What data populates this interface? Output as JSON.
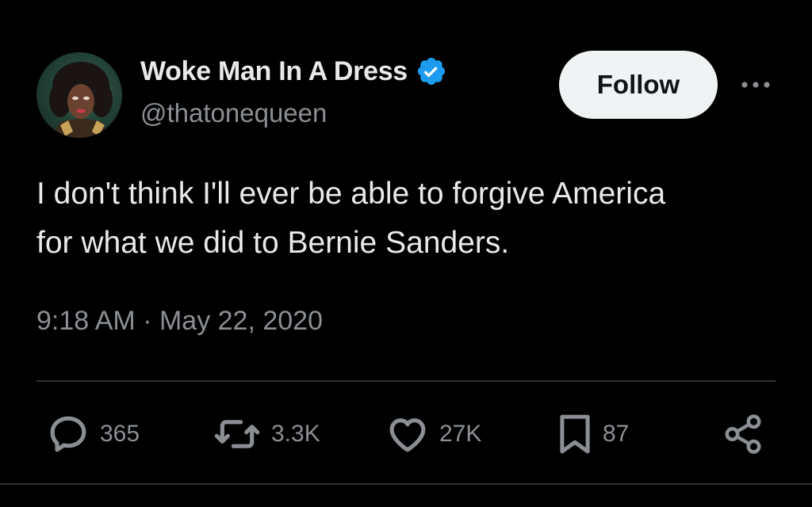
{
  "author": {
    "display_name": "Woke Man In A Dress",
    "handle": "@thatonequeen",
    "verified": true,
    "avatar_icon": "profile-photo"
  },
  "header": {
    "follow_label": "Follow",
    "more_icon": "more-horizontal-icon"
  },
  "tweet": {
    "text_lines": [
      "I don't think I'll ever be able to forgive America",
      "for what we did to Bernie Sanders."
    ],
    "timestamp": "9:18 AM · May 22, 2020"
  },
  "actions": {
    "replies": {
      "icon": "reply-icon",
      "count": "365"
    },
    "retweets": {
      "icon": "retweet-icon",
      "count": "3.3K"
    },
    "likes": {
      "icon": "heart-icon",
      "count": "27K"
    },
    "bookmarks": {
      "icon": "bookmark-icon",
      "count": "87"
    },
    "share": {
      "icon": "share-icon"
    }
  },
  "colors": {
    "background": "#000000",
    "primary_text": "#e7e9ea",
    "secondary_text": "#8b8f94",
    "verified_blue": "#1d9bf0",
    "follow_bg": "#eff3f4",
    "divider": "#2f3336"
  }
}
